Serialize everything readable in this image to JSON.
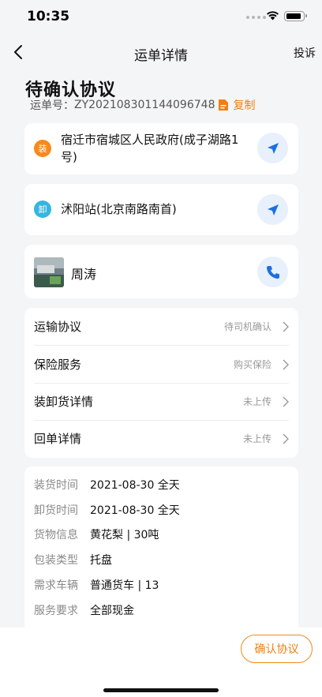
{
  "status_bar": {
    "time": "10:35"
  },
  "nav": {
    "title": "运单详情",
    "complaint": "投诉"
  },
  "header": {
    "status": "待确认协议",
    "waybill_label": "运单号：",
    "waybill_no": "ZY20210830114409674​8",
    "copy_label": "复制"
  },
  "loading": {
    "badge": "装",
    "address": "宿迁市宿城区人民政府(成子湖路1号)"
  },
  "unloading": {
    "badge": "卸",
    "address": "沭阳站(北京南路南首)"
  },
  "driver": {
    "name": "周涛"
  },
  "menu": [
    {
      "label": "运输协议",
      "value": "待司机确认"
    },
    {
      "label": "保险服务",
      "value": "购买保险"
    },
    {
      "label": "装卸货详情",
      "value": "未上传"
    },
    {
      "label": "回单详情",
      "value": "未上传"
    }
  ],
  "info": [
    {
      "key": "装货时间",
      "value": "2021-08-30 全天"
    },
    {
      "key": "卸货时间",
      "value": "2021-08-30 全天"
    },
    {
      "key": "货物信息",
      "value": "黄花梨 | 30吨"
    },
    {
      "key": "包装类型",
      "value": "托盘"
    },
    {
      "key": "需求车辆",
      "value": "普通货车 | 13"
    },
    {
      "key": "服务要求",
      "value": "全部现金"
    }
  ],
  "footer": {
    "confirm_label": "确认协议"
  },
  "colors": {
    "accent": "#f07f12",
    "load_badge": "#f58a1f",
    "unload_badge": "#35b6e0",
    "action_blue": "#1c6fe0"
  },
  "icons": [
    "back-icon",
    "wifi-icon",
    "battery-icon",
    "document-icon",
    "navigate-icon",
    "phone-icon",
    "chevron-right-icon"
  ]
}
